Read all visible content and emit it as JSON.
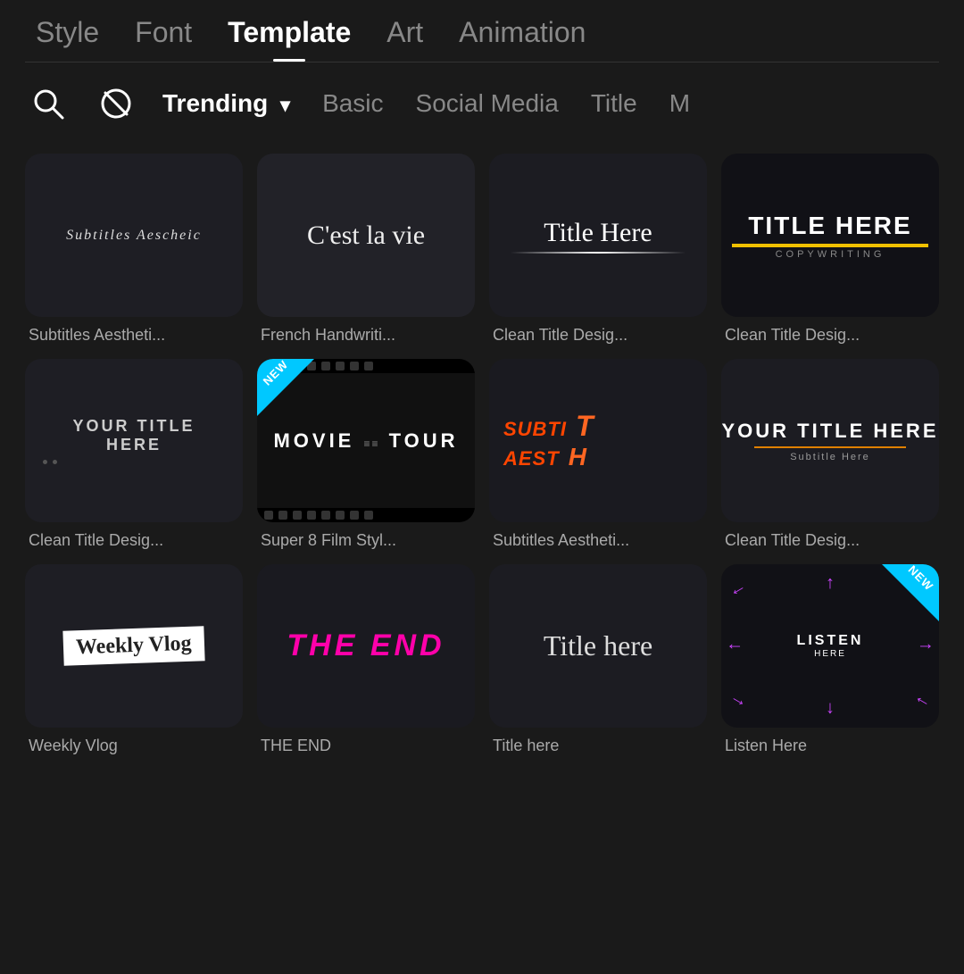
{
  "nav": {
    "items": [
      {
        "id": "style",
        "label": "Style",
        "active": false
      },
      {
        "id": "font",
        "label": "Font",
        "active": false
      },
      {
        "id": "template",
        "label": "Template",
        "active": true
      },
      {
        "id": "art",
        "label": "Art",
        "active": false
      },
      {
        "id": "animation",
        "label": "Animation",
        "active": false
      }
    ]
  },
  "filters": {
    "search_icon": "search",
    "block_icon": "block",
    "tags": [
      {
        "id": "trending",
        "label": "Trending",
        "active": true,
        "has_dropdown": true
      },
      {
        "id": "basic",
        "label": "Basic",
        "active": false
      },
      {
        "id": "social_media",
        "label": "Social Media",
        "active": false
      },
      {
        "id": "title",
        "label": "Title",
        "active": false
      },
      {
        "id": "more",
        "label": "M...",
        "active": false
      }
    ]
  },
  "cards": [
    {
      "id": "subtitles-aesthetic-1",
      "thumb_type": "subtitles-aesthetic",
      "label": "Subtitles Aestheti...",
      "inner_text": "Subtitles Aescheic",
      "is_new": false
    },
    {
      "id": "french-handwriting",
      "thumb_type": "french",
      "label": "French Handwriti...",
      "inner_text": "C'est la vie",
      "is_new": false
    },
    {
      "id": "clean-title-script",
      "thumb_type": "clean-script",
      "label": "Clean Title Desig...",
      "inner_text": "Title Here",
      "is_new": false
    },
    {
      "id": "clean-title-bold",
      "thumb_type": "title-bold",
      "label": "Clean Title Desig...",
      "main_title": "TITLE HERE",
      "sub_title": "COPYWRITING",
      "is_new": false
    },
    {
      "id": "your-title-here",
      "thumb_type": "your-title",
      "label": "Clean Title Desig...",
      "inner_text": "YOUR TITLE HERE",
      "is_new": false
    },
    {
      "id": "movie-tour",
      "thumb_type": "movie-tour",
      "label": "Super 8 Film Styl...",
      "movie_text": "MOVIE",
      "movie_tour": "TOUR",
      "is_new": true,
      "badge_pos": "left"
    },
    {
      "id": "subtitles-aesthetic-2",
      "thumb_type": "subti",
      "label": "Subtitles Aestheti...",
      "is_new": false
    },
    {
      "id": "clean-title-bar",
      "thumb_type": "clean-bar",
      "label": "Clean Title Desig...",
      "main_title": "YOUR TITLE HERE",
      "subtitle": "Subtitle Here",
      "is_new": false
    },
    {
      "id": "weekly-vlog",
      "thumb_type": "weekly",
      "label": "Weekly Vlog",
      "vlog_text": "Weekly Vlog",
      "is_new": false
    },
    {
      "id": "the-end",
      "thumb_type": "the-end",
      "label": "THE END",
      "end_text": "THE END",
      "is_new": false
    },
    {
      "id": "title-here-script",
      "thumb_type": "title-script",
      "label": "Title here",
      "script_text": "Title here",
      "is_new": false
    },
    {
      "id": "listen-here",
      "thumb_type": "listen",
      "label": "Listen Here",
      "listen_text": "LISTEN\nHERE",
      "is_new": true,
      "badge_pos": "right"
    }
  ]
}
